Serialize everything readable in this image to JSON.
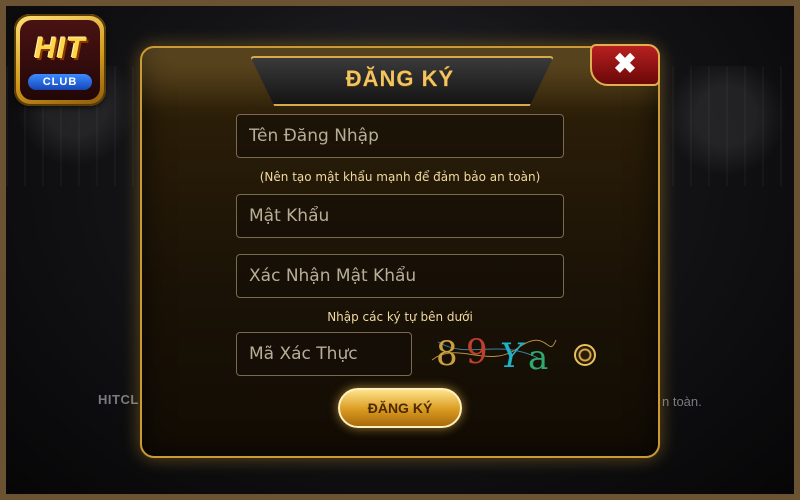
{
  "background": {
    "left_text": "HITCL",
    "right_text": "n toàn."
  },
  "logo": {
    "hit": "HIT",
    "club": "CLUB"
  },
  "modal": {
    "title": "ĐĂNG KÝ",
    "close_label": "✖",
    "username_placeholder": "Tên Đăng Nhập",
    "password_hint": "(Nên tạo mật khẩu mạnh để đảm bảo an toàn)",
    "password_placeholder": "Mật Khẩu",
    "confirm_placeholder": "Xác Nhận Mật Khẩu",
    "captcha_hint": "Nhập các ký tự bên dưới",
    "captcha_placeholder": "Mã Xác Thực",
    "captcha_chars": [
      "8",
      "9",
      "Y",
      "a"
    ],
    "submit_label": "ĐĂNG KÝ"
  },
  "colors": {
    "accent_gold": "#f2c560",
    "captcha": [
      "#c8a040",
      "#c04030",
      "#20b0c8",
      "#30a870"
    ]
  }
}
